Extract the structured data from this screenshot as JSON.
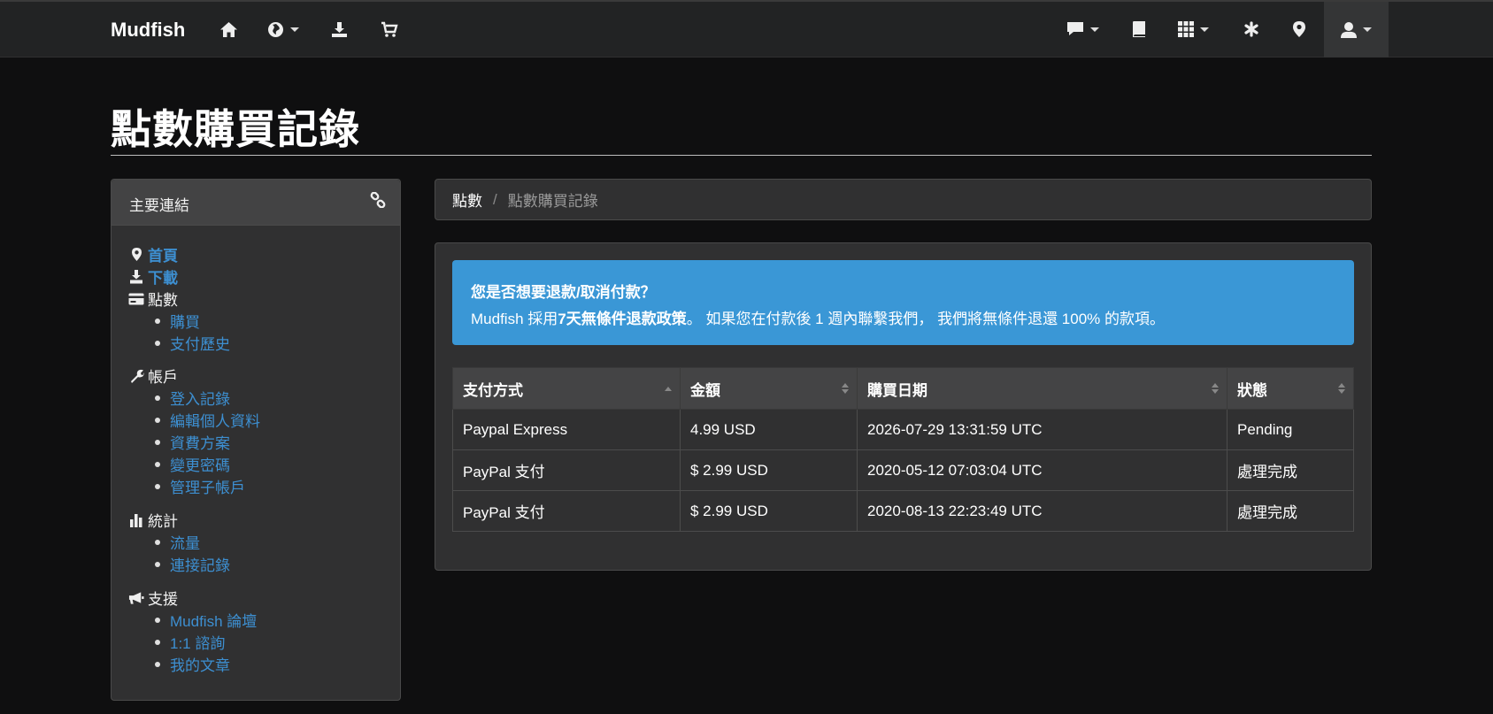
{
  "navbar": {
    "brand": "Mudfish",
    "icons": [
      "home-icon",
      "globe-icon",
      "download-icon",
      "cart-icon",
      "chat-icon",
      "book-icon",
      "grid-icon",
      "asterisk-icon",
      "map-marker-icon",
      "user-icon"
    ]
  },
  "page": {
    "title": "點數購買記錄"
  },
  "sidebar": {
    "header": "主要連結",
    "home": "首頁",
    "download": "下載",
    "credits": {
      "label": "點數",
      "items": [
        "購買",
        "支付歷史"
      ]
    },
    "account": {
      "label": "帳戶",
      "items": [
        "登入記錄",
        "編輯個人資料",
        "資費方案",
        "變更密碼",
        "管理子帳戶"
      ]
    },
    "stats": {
      "label": "統計",
      "items": [
        "流量",
        "連接記錄"
      ]
    },
    "support": {
      "label": "支援",
      "items": [
        "Mudfish 論壇",
        "1:1 諮詢",
        "我的文章"
      ]
    }
  },
  "breadcrumb": {
    "home": "點數",
    "separator": "/",
    "current": "點數購買記錄"
  },
  "alert": {
    "title": "您是否想要退款/取消付款？",
    "body_prefix": "Mudfish 採用",
    "body_bold": "7天無條件退款政策",
    "body_suffix": "。 如果您在付款後 1 週內聯繫我們， 我們將無條件退還 100% 的款項。"
  },
  "table": {
    "headers": [
      "支付方式",
      "金額",
      "購買日期",
      "狀態"
    ],
    "rows": [
      [
        "Paypal Express",
        "4.99 USD",
        "2026-07-29 13:31:59 UTC",
        "Pending"
      ],
      [
        "PayPal 支付",
        "$ 2.99 USD",
        "2020-05-12 07:03:04 UTC",
        "處理完成"
      ],
      [
        "PayPal 支付",
        "$ 2.99 USD",
        "2020-08-13 22:23:49 UTC",
        "處理完成"
      ]
    ]
  },
  "colors": {
    "accent": "#3a97d6",
    "link": "#3d8fd1",
    "background": "#0f0f10",
    "panel": "#303031"
  }
}
